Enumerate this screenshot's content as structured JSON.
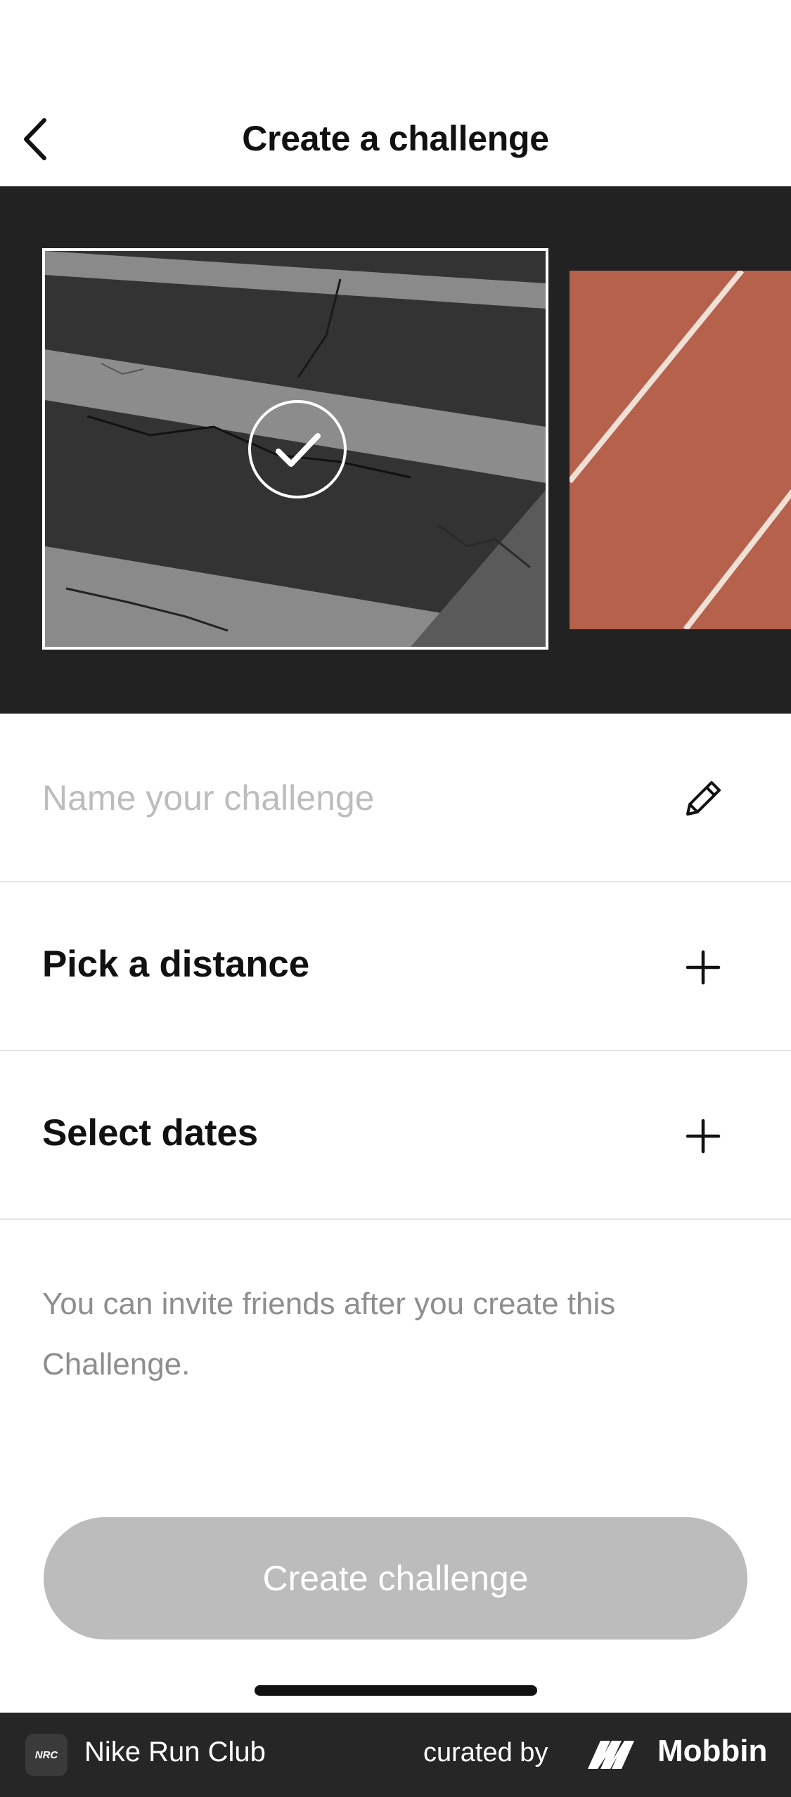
{
  "header": {
    "title": "Create a challenge"
  },
  "carousel": {
    "selected_image": "asphalt-crosswalk",
    "other_image": "running-track"
  },
  "form": {
    "name_placeholder": "Name your challenge",
    "name_value": "",
    "distance_label": "Pick a distance",
    "dates_label": "Select dates"
  },
  "hint": "You can invite friends after you create this Challenge.",
  "create_button": {
    "label": "Create challenge",
    "enabled": false
  },
  "footer": {
    "app_name": "Nike Run Club",
    "app_icon_text": "NRC",
    "curated_by": "curated by",
    "brand": "Mobbin"
  },
  "colors": {
    "carousel_bg": "#222222",
    "button_disabled": "#bcbcbc",
    "track_red": "#b5614c",
    "placeholder": "#bdbdbd",
    "hint": "#8e8e8e"
  }
}
